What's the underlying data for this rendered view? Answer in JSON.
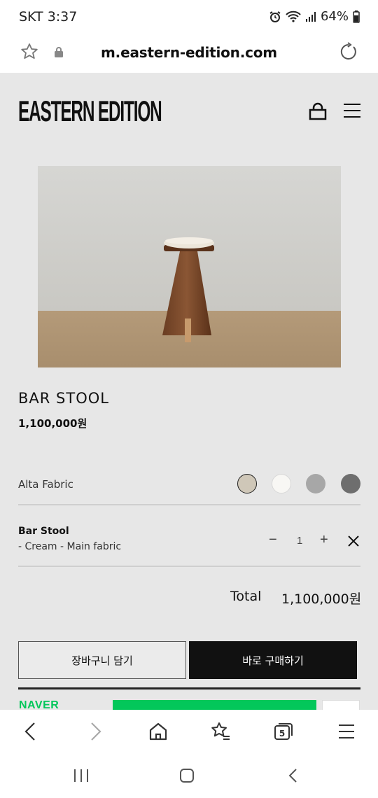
{
  "status_bar": {
    "carrier_time": "SKT 3:37",
    "battery": "64%"
  },
  "browser": {
    "url": "m.eastern-edition.com"
  },
  "site": {
    "brand": "EASTERN EDITION"
  },
  "product": {
    "title": "BAR STOOL",
    "price": "1,100,000원",
    "option_label": "Alta Fabric",
    "swatches": [
      {
        "name": "cream",
        "color": "#cfc7b8",
        "selected": true
      },
      {
        "name": "white",
        "color": "#f8f7f4",
        "selected": false
      },
      {
        "name": "light-gray",
        "color": "#a7a7a7",
        "selected": false
      },
      {
        "name": "dark-gray",
        "color": "#6e6e6e",
        "selected": false
      }
    ]
  },
  "cart_item": {
    "name": "Bar Stool",
    "variant": "- Cream - Main fabric",
    "qty_minus": "−",
    "quantity": "1",
    "qty_plus": "+"
  },
  "total": {
    "label": "Total",
    "value": "1,100,000원"
  },
  "actions": {
    "add_to_cart": "장바구니 담기",
    "buy_now": "바로 구매하기"
  },
  "naver": {
    "logo": "NAVER"
  },
  "colors": {
    "page_bg": "#e7e7e7",
    "buy_button": "#111111",
    "naver_green": "#03c75a"
  }
}
